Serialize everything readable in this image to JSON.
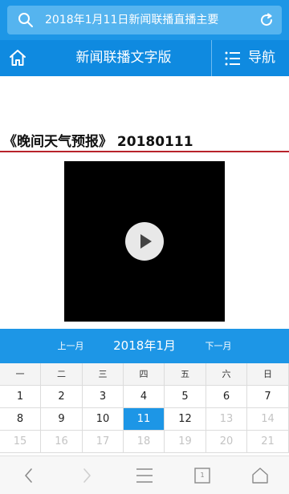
{
  "search": {
    "query": "2018年1月11日新闻联播直播主要"
  },
  "header": {
    "title": "新闻联播文字版",
    "nav_label": "导航"
  },
  "article": {
    "title": "《晚间天气预报》 20180111"
  },
  "calendar": {
    "prev_label": "上一月",
    "month_label": "2018年1月",
    "next_label": "下一月",
    "weekdays": [
      "一",
      "二",
      "三",
      "四",
      "五",
      "六",
      "日"
    ],
    "weeks": [
      [
        "1",
        "2",
        "3",
        "4",
        "5",
        "6",
        "7"
      ],
      [
        "8",
        "9",
        "10",
        "11",
        "12",
        "13",
        "14"
      ],
      [
        "15",
        "16",
        "17",
        "18",
        "19",
        "20",
        "21"
      ]
    ],
    "selected_day": "11",
    "last_enabled_day": 12
  },
  "toolbar": {
    "tabs_count": "1"
  },
  "colors": {
    "accent": "#1d96e6",
    "title_rule": "#b8232b"
  }
}
